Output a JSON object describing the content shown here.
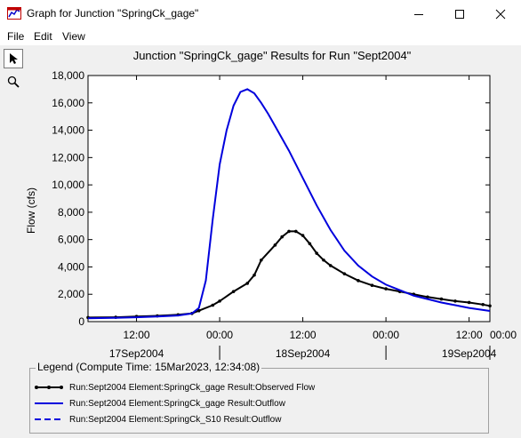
{
  "window": {
    "title": "Graph for Junction \"SpringCk_gage\"",
    "controls": [
      "minimize-icon",
      "maximize-icon",
      "close-icon"
    ]
  },
  "menu": {
    "items": [
      "File",
      "Edit",
      "View"
    ]
  },
  "toolbar": {
    "tools": [
      "pointer-arrow-icon",
      "zoom-magnifier-icon"
    ]
  },
  "chart_data": {
    "type": "line",
    "title": "Junction \"SpringCk_gage\" Results for Run \"Sept2004\"",
    "ylabel": "Flow (cfs)",
    "xlabel": "",
    "ylim": [
      0,
      18000
    ],
    "yticks": [
      "0",
      "2,000",
      "4,000",
      "6,000",
      "8,000",
      "10,000",
      "12,000",
      "14,000",
      "16,000",
      "18,000"
    ],
    "x_range_hours": [
      -19,
      39
    ],
    "x_hour_ticks": [
      {
        "hour": -12,
        "label": "12:00"
      },
      {
        "hour": 0,
        "label": "00:00"
      },
      {
        "hour": 12,
        "label": "12:00"
      },
      {
        "hour": 24,
        "label": "00:00"
      },
      {
        "hour": 36,
        "label": "12:00"
      },
      {
        "hour": 48,
        "label": "00:00"
      }
    ],
    "x_day_labels": [
      {
        "center_hour": -12,
        "label": "17Sep2004"
      },
      {
        "center_hour": 12,
        "label": "18Sep2004"
      },
      {
        "center_hour": 36,
        "label": "19Sep2004"
      }
    ],
    "day_separators_hours": [
      0,
      24,
      48
    ],
    "grid": false,
    "series": [
      {
        "name": "Run:Sept2004 Element:SpringCk_gage Result:Observed Flow",
        "color": "#000000",
        "style": "solid-markers",
        "x": [
          -19,
          -15,
          -12,
          -9,
          -6,
          -4,
          -3,
          -1,
          0,
          2,
          4,
          5,
          6,
          8,
          9,
          10,
          11,
          12,
          13,
          14,
          15,
          16,
          18,
          20,
          22,
          24,
          26,
          28,
          30,
          32,
          34,
          36,
          38,
          39
        ],
        "y": [
          300,
          320,
          380,
          420,
          500,
          600,
          800,
          1200,
          1500,
          2200,
          2800,
          3400,
          4500,
          5600,
          6200,
          6600,
          6600,
          6300,
          5700,
          5000,
          4500,
          4100,
          3500,
          3000,
          2650,
          2400,
          2200,
          2000,
          1800,
          1650,
          1500,
          1400,
          1250,
          1150
        ]
      },
      {
        "name": "Run:Sept2004 Element:SpringCk_gage Result:Outflow",
        "color": "#0000dd",
        "style": "solid",
        "x": [
          -19,
          -15,
          -12,
          -9,
          -6,
          -4,
          -3,
          -2,
          -1,
          0,
          1,
          2,
          3,
          4,
          5,
          6,
          7,
          8,
          10,
          12,
          14,
          16,
          18,
          20,
          22,
          24,
          26,
          28,
          30,
          32,
          34,
          36,
          38,
          39
        ],
        "y": [
          250,
          280,
          320,
          380,
          450,
          600,
          1000,
          3000,
          7500,
          11500,
          14000,
          15800,
          16800,
          17000,
          16700,
          16000,
          15200,
          14300,
          12500,
          10500,
          8500,
          6700,
          5200,
          4100,
          3300,
          2700,
          2300,
          1900,
          1650,
          1400,
          1200,
          1000,
          850,
          780
        ]
      }
    ],
    "legend": {
      "title": "Legend (Compute Time: 15Mar2023, 12:34:08)",
      "entries": [
        {
          "label": "Run:Sept2004 Element:SpringCk_gage Result:Observed Flow",
          "color": "#000000",
          "style": "solid-markers"
        },
        {
          "label": "Run:Sept2004 Element:SpringCk_gage Result:Outflow",
          "color": "#0000dd",
          "style": "solid"
        },
        {
          "label": "Run:Sept2004 Element:SpringCk_S10 Result:Outflow",
          "color": "#0000dd",
          "style": "dashed"
        }
      ],
      "placement": "bottom"
    }
  }
}
